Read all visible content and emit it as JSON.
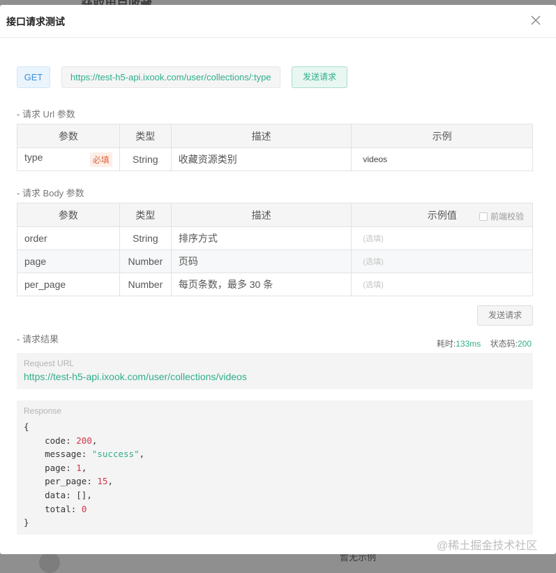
{
  "backdrop": {
    "title": "获取用户收藏",
    "bottom_text": "暂无示例"
  },
  "dialog": {
    "title": "接口请求测试",
    "close_icon": "close-icon"
  },
  "request": {
    "method": "GET",
    "url": "https://test-h5-api.ixook.com/user/collections/:type",
    "send_label": "发送请求"
  },
  "url_params": {
    "section_label": "- 请求 Url 参数",
    "headers": [
      "参数",
      "类型",
      "描述",
      "示例"
    ],
    "rows": [
      {
        "name": "type",
        "required": "必填",
        "type": "String",
        "desc": "收藏资源类别",
        "example": "videos"
      }
    ]
  },
  "body_params": {
    "section_label": "- 请求 Body 参数",
    "headers": [
      "参数",
      "类型",
      "描述",
      "示例值"
    ],
    "frontend_check_label": "前端校验",
    "rows": [
      {
        "name": "order",
        "type": "String",
        "desc": "排序方式",
        "placeholder": "(选填)"
      },
      {
        "name": "page",
        "type": "Number",
        "desc": "页码",
        "placeholder": "(选填)"
      },
      {
        "name": "per_page",
        "type": "Number",
        "desc": "每页条数，最多 30 条",
        "placeholder": "(选填)"
      }
    ],
    "send_label": "发送请求"
  },
  "result": {
    "section_label": "- 请求结果",
    "time_label": "耗时:",
    "time_value": "133ms",
    "status_label": "状态码:",
    "status_value": "200",
    "request_url_label": "Request URL",
    "request_url": "https://test-h5-api.ixook.com/user/collections/videos",
    "response_label": "Response",
    "response": {
      "open": "{",
      "code_key": "code",
      "code_val": "200",
      "message_key": "message",
      "message_val": "\"success\"",
      "page_key": "page",
      "page_val": "1",
      "per_page_key": "per_page",
      "per_page_val": "15",
      "data_key": "data",
      "data_val": "[]",
      "total_key": "total",
      "total_val": "0",
      "close": "}"
    }
  },
  "watermark": "@稀土掘金技术社区"
}
